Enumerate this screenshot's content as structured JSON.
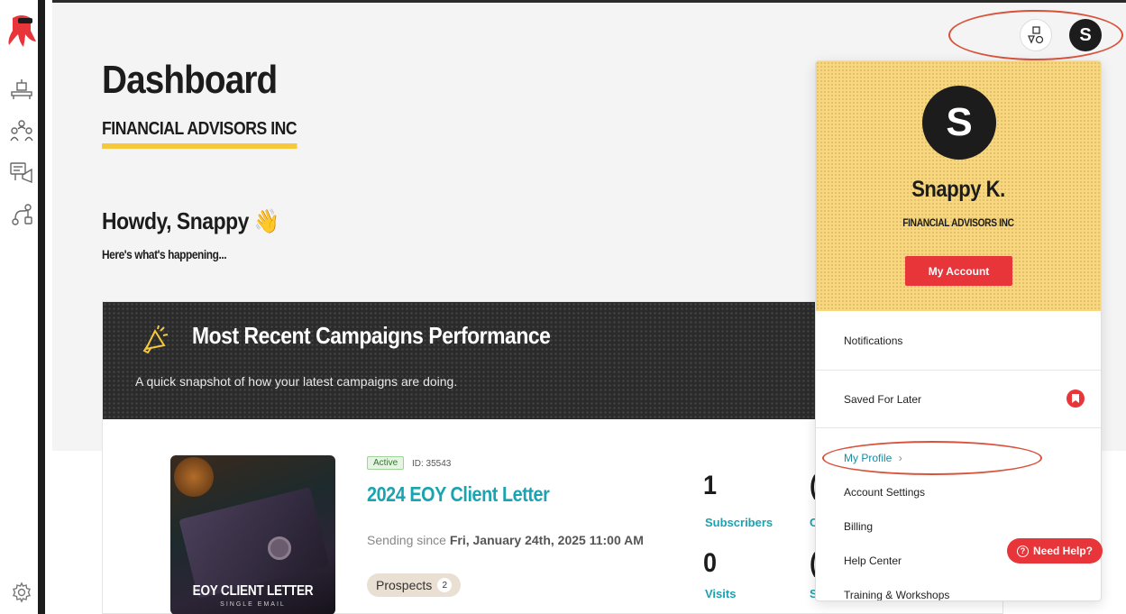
{
  "page": {
    "title": "Dashboard",
    "company": "FINANCIAL ADVISORS INC",
    "greeting": "Howdy, Snappy",
    "greeting_emoji": "👋",
    "subtitle": "Here's what's happening..."
  },
  "sidebar": {
    "items": [
      "desk-icon",
      "team-icon",
      "campaigns-icon",
      "workflows-icon"
    ],
    "bottom": "gear-icon"
  },
  "campaign_card": {
    "title": "Most Recent Campaigns Performance",
    "subtitle": "A quick snapshot of how your latest campaigns are doing.",
    "status": "Active",
    "id": "ID: 35543",
    "name": "2024 EOY Client Letter",
    "sending_prefix": "Sending since ",
    "sending_date": "Fri, January 24th, 2025 11:00 AM",
    "tag_label": "Prospects",
    "tag_count": "2",
    "thumb_title": "EOY CLIENT LETTER",
    "thumb_sub": "SINGLE EMAIL",
    "stats": [
      {
        "value": "1",
        "label": "Subscribers"
      },
      {
        "value": "0",
        "label": "Visits"
      }
    ],
    "partial_stats": [
      "(",
      "(",
      "C",
      "S"
    ]
  },
  "header": {
    "avatar_initial": "S"
  },
  "dropdown": {
    "avatar_initial": "S",
    "name": "Snappy K.",
    "company": "FINANCIAL ADVISORS INC",
    "account_button": "My Account",
    "items": {
      "notifications": "Notifications",
      "saved": "Saved For Later",
      "profile": "My Profile",
      "profile_chevron": "›",
      "account_settings": "Account Settings",
      "billing": "Billing",
      "help_center": "Help Center",
      "training": "Training & Workshops"
    }
  },
  "help": {
    "label": "Need Help?",
    "icon_glyph": "?"
  },
  "colors": {
    "accent_red": "#e8353a",
    "accent_teal": "#1aa3b0",
    "accent_yellow": "#f8d77e",
    "annotation_red": "#d9533b"
  }
}
